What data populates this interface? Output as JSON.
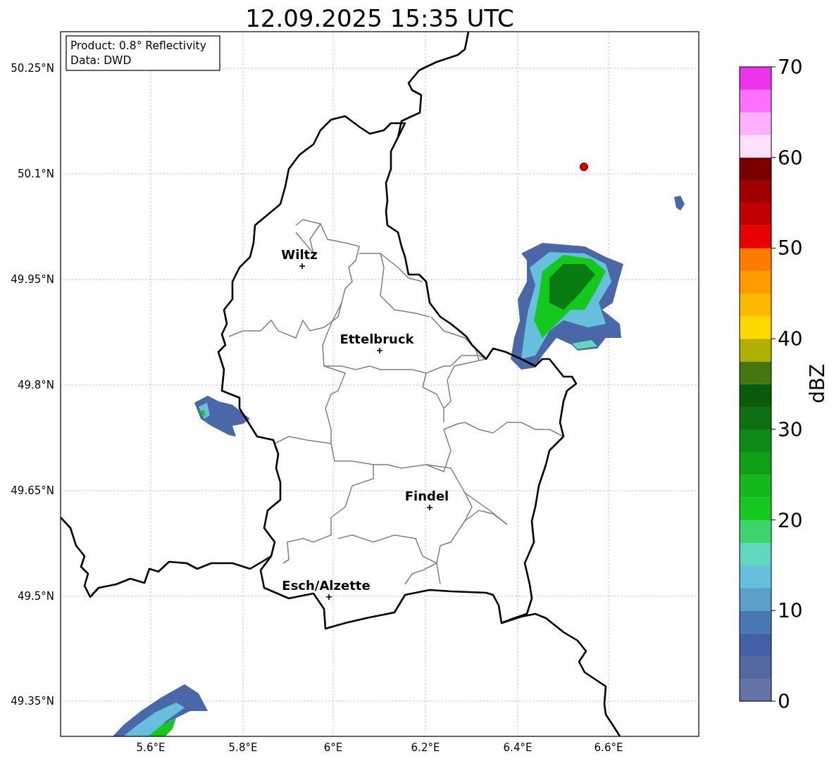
{
  "title": "12.09.2025 15:35 UTC",
  "info": [
    "Product: 0.8° Reflectivity",
    "Data: DWD"
  ],
  "latitude_labels": [
    "50.25°N",
    "50.1°N",
    "49.95°N",
    "49.8°N",
    "49.65°N",
    "49.5°N",
    "49.35°N"
  ],
  "longitude_labels": [
    "5.6°E",
    "5.8°E",
    "6°E",
    "6.2°E",
    "6.4°E",
    "6.6°E"
  ],
  "cities": [
    {
      "name": "Wiltz"
    },
    {
      "name": "Ettelbruck"
    },
    {
      "name": "Findel"
    },
    {
      "name": "Esch/Alzette"
    }
  ],
  "colorbar": {
    "label": "dBZ",
    "ticks": [
      "70",
      "60",
      "50",
      "40",
      "30",
      "20",
      "10",
      "0"
    ],
    "bins": [
      {
        "color": "#6474a6"
      },
      {
        "color": "#5468a0"
      },
      {
        "color": "#4460a6"
      },
      {
        "color": "#4a78b4"
      },
      {
        "color": "#5ba0c8"
      },
      {
        "color": "#66c0dc"
      },
      {
        "color": "#60d8c0"
      },
      {
        "color": "#3ed46c"
      },
      {
        "color": "#14c81e"
      },
      {
        "color": "#12b81c"
      },
      {
        "color": "#10a018"
      },
      {
        "color": "#0e8a16"
      },
      {
        "color": "#0d7014"
      },
      {
        "color": "#0a5a0c"
      },
      {
        "color": "#46760e"
      },
      {
        "color": "#b0b000"
      },
      {
        "color": "#ffd800"
      },
      {
        "color": "#ffb800"
      },
      {
        "color": "#ff9a00"
      },
      {
        "color": "#ff7c00"
      },
      {
        "color": "#e80000"
      },
      {
        "color": "#c00000"
      },
      {
        "color": "#a00000"
      },
      {
        "color": "#7a0000"
      },
      {
        "color": "#ffe0ff"
      },
      {
        "color": "#ffb0ff"
      },
      {
        "color": "#ff70ff"
      },
      {
        "color": "#ee33ee"
      }
    ]
  }
}
